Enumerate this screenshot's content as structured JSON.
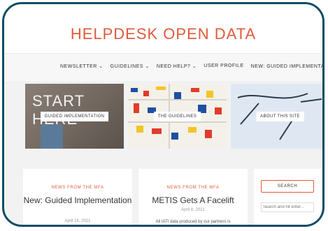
{
  "site": {
    "title": "HELPDESK OPEN DATA"
  },
  "nav": [
    {
      "label": "NEWSLETTER ⌄"
    },
    {
      "label": "GUIDELINES ⌄"
    },
    {
      "label": "NEED HELP? ⌄"
    },
    {
      "label": "USER PROFILE"
    },
    {
      "label": "NEW: GUIDED IMPLEMENTATION ⌄"
    }
  ],
  "tiles": [
    {
      "image_text": "START HERE",
      "label": "GUIDED IMPLEMENTATION"
    },
    {
      "label": "THE GUIDELINES"
    },
    {
      "label": "ABOUT THIS SITE"
    }
  ],
  "posts": [
    {
      "category": "NEWS FROM THE MFA",
      "title": "New: Guided Implementation",
      "date": "April 16, 2021"
    },
    {
      "category": "NEWS FROM THE MFA",
      "title": "METIS Gets A Facelift",
      "date": "April 8, 2021",
      "excerpt": "All IATI data produced by our partners is"
    }
  ],
  "search": {
    "button_label": "SEARCH",
    "placeholder": "Search and hit enter..."
  }
}
